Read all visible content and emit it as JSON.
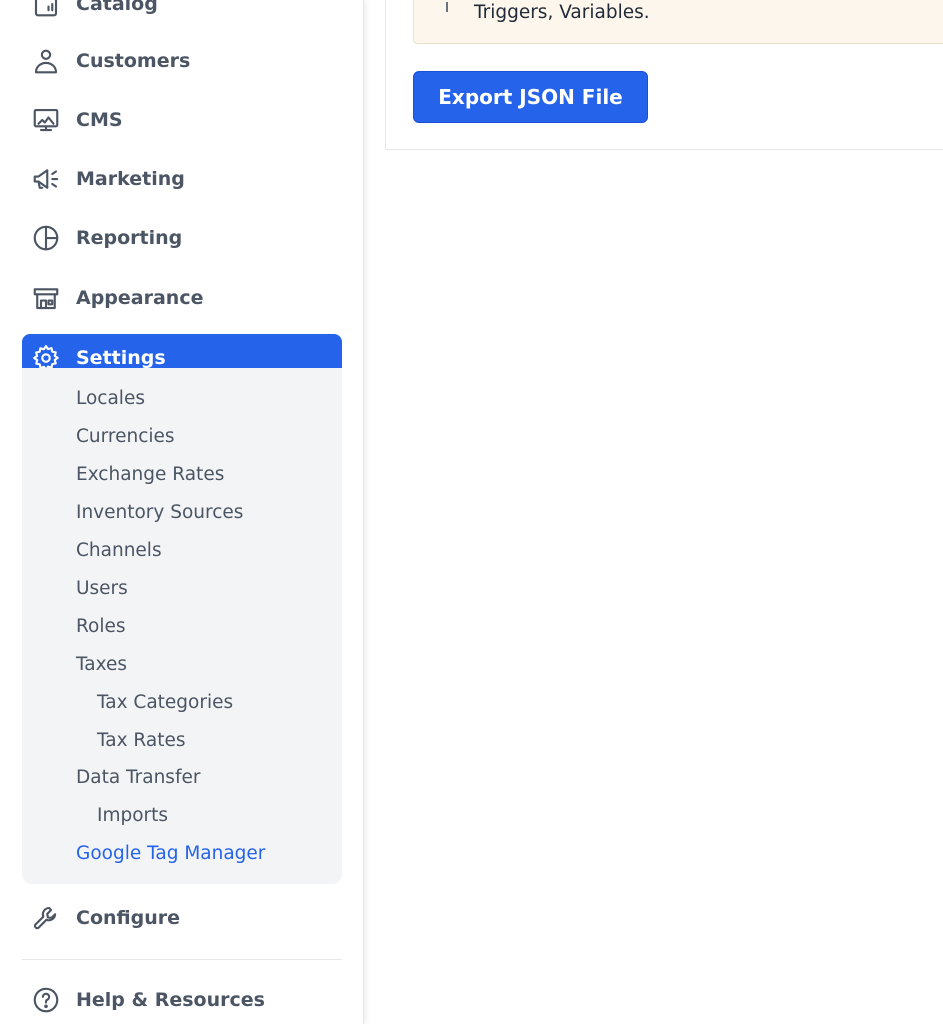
{
  "sidebar": {
    "items": [
      {
        "label": "Catalog",
        "icon": "catalog-icon"
      },
      {
        "label": "Customers",
        "icon": "person-icon"
      },
      {
        "label": "CMS",
        "icon": "monitor-icon"
      },
      {
        "label": "Marketing",
        "icon": "megaphone-icon"
      },
      {
        "label": "Reporting",
        "icon": "pie-chart-icon"
      },
      {
        "label": "Appearance",
        "icon": "storefront-icon"
      },
      {
        "label": "Settings",
        "icon": "gear-icon",
        "active": true
      },
      {
        "label": "Configure",
        "icon": "wrench-icon"
      },
      {
        "label": "Help & Resources",
        "icon": "help-icon"
      }
    ],
    "settings_submenu": [
      {
        "label": "Locales"
      },
      {
        "label": "Currencies"
      },
      {
        "label": "Exchange Rates"
      },
      {
        "label": "Inventory Sources"
      },
      {
        "label": "Channels"
      },
      {
        "label": "Users"
      },
      {
        "label": "Roles"
      },
      {
        "label": "Taxes"
      },
      {
        "label": "Tax Categories"
      },
      {
        "label": "Tax Rates"
      },
      {
        "label": "Data Transfer"
      },
      {
        "label": "Imports"
      },
      {
        "label": "Google Tag Manager",
        "current": true
      }
    ]
  },
  "main": {
    "notice_text": "Triggers, Variables.",
    "export_button_label": "Export JSON File"
  },
  "colors": {
    "accent": "#2563eb",
    "sidebar_text": "#4b5563",
    "submenu_bg": "#f3f4f6",
    "notice_bg": "#fdf6ec"
  }
}
